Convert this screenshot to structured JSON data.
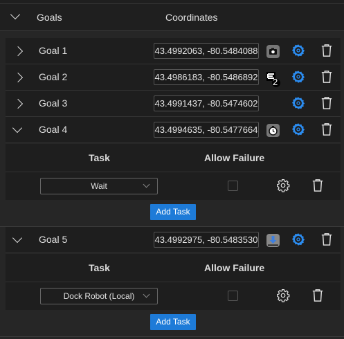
{
  "header": {
    "goals_label": "Goals",
    "coordinates_label": "Coordinates"
  },
  "goals": [
    {
      "name": "Goal 1",
      "coordinates": "43.4992063, -80.5484088",
      "action_icon": "camera-icon"
    },
    {
      "name": "Goal 2",
      "coordinates": "43.4986183, -80.5486892",
      "action_icon": "elevator-floor-icon",
      "badge": "2"
    },
    {
      "name": "Goal 3",
      "coordinates": "43.4991437, -80.5474602"
    },
    {
      "name": "Goal 4",
      "coordinates": "43.4994635, -80.5477664",
      "action_icon": "timer-icon",
      "expanded": true,
      "task_header": "Task",
      "allow_failure_header": "Allow Failure",
      "tasks": [
        {
          "task": "Wait",
          "allow_failure": false
        }
      ],
      "add_task": "Add Task"
    },
    {
      "name": "Goal 5",
      "coordinates": "43.4992975, -80.5483530",
      "action_icon": "dock-icon",
      "expanded": true,
      "task_header": "Task",
      "allow_failure_header": "Allow Failure",
      "tasks": [
        {
          "task": "Dock Robot (Local)",
          "allow_failure": false
        }
      ],
      "add_task": "Add Task"
    }
  ],
  "colors": {
    "accent": "#1e7bd8",
    "gear": "#2b8cf0"
  }
}
